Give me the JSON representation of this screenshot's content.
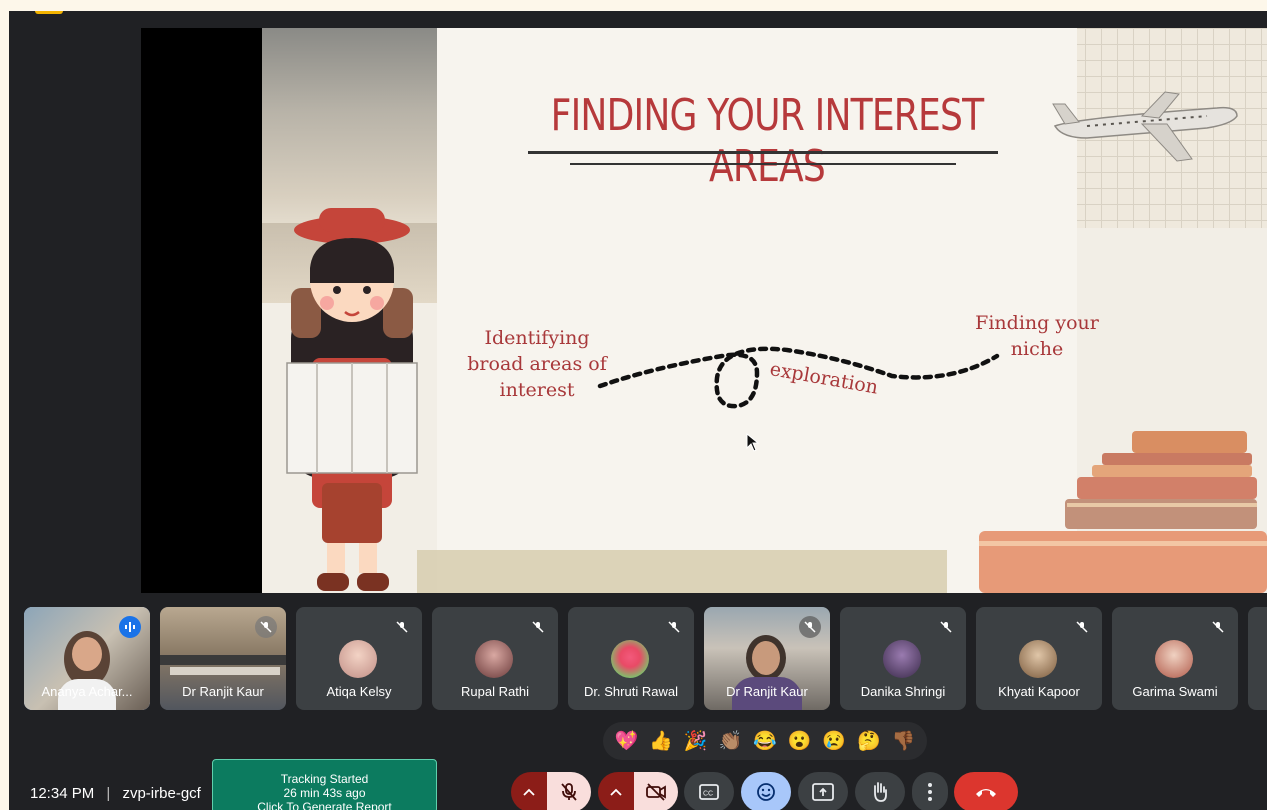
{
  "slide": {
    "title": "FINDING YOUR INTEREST AREAS",
    "label_left": "Identifying broad areas of interest",
    "label_middle": "exploration",
    "label_right": "Finding your niche"
  },
  "participants": [
    {
      "name": "Ananya Achar...",
      "state": "speaking",
      "kind": "video"
    },
    {
      "name": "Dr Ranjit Kaur",
      "state": "muted",
      "kind": "video"
    },
    {
      "name": "Atiqa Kelsy",
      "state": "muted",
      "kind": "avatar"
    },
    {
      "name": "Rupal Rathi",
      "state": "muted",
      "kind": "avatar"
    },
    {
      "name": "Dr. Shruti Rawal",
      "state": "muted",
      "kind": "avatar"
    },
    {
      "name": "Dr Ranjit Kaur",
      "state": "muted",
      "kind": "video"
    },
    {
      "name": "Danika Shringi",
      "state": "muted",
      "kind": "avatar"
    },
    {
      "name": "Khyati Kapoor",
      "state": "muted",
      "kind": "avatar"
    },
    {
      "name": "Garima Swami",
      "state": "muted",
      "kind": "avatar"
    }
  ],
  "reactions": [
    "💖",
    "👍",
    "🎉",
    "👏🏽",
    "😂",
    "😮",
    "😢",
    "🤔",
    "👎🏾"
  ],
  "meeting": {
    "time": "12:34 PM",
    "separator": "|",
    "code": "zvp-irbe-gcf"
  },
  "tracker": {
    "line1": "Tracking Started",
    "line2": "26 min 43s ago",
    "line3": "Click To Generate Report"
  },
  "colors": {
    "accent": "#8ab4f8",
    "end_call": "#dc362e",
    "tracker": "#0c7b5f",
    "slide_title": "#b6393b"
  },
  "icons": {
    "mic": "mic-off-icon",
    "camera": "camera-off-icon",
    "captions": "captions-icon",
    "emoji": "emoji-icon",
    "present": "present-icon",
    "hand": "raise-hand-icon",
    "more": "more-vert-icon",
    "end": "end-call-icon"
  }
}
